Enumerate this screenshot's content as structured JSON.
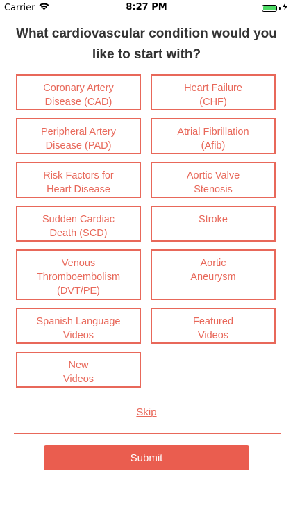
{
  "status_bar": {
    "carrier": "Carrier",
    "time": "8:27 PM",
    "wifi_icon": "wifi-icon",
    "battery_icon": "battery-icon",
    "charging_icon": "charging-bolt-icon",
    "battery_color": "#4cd964"
  },
  "question": "What cardiovascular condition would you like to start with?",
  "options": [
    {
      "label": "Coronary Artery\nDisease (CAD)"
    },
    {
      "label": "Heart Failure\n(CHF)"
    },
    {
      "label": "Peripheral Artery\nDisease (PAD)"
    },
    {
      "label": "Atrial Fibrillation\n(Afib)"
    },
    {
      "label": "Risk Factors for\nHeart Disease"
    },
    {
      "label": "Aortic Valve\nStenosis"
    },
    {
      "label": "Sudden Cardiac\nDeath (SCD)"
    },
    {
      "label": "Stroke"
    },
    {
      "label": "Venous\nThromboembolism\n(DVT/PE)"
    },
    {
      "label": "Aortic\nAneurysm"
    },
    {
      "label": "Spanish Language\nVideos"
    },
    {
      "label": "Featured\nVideos"
    },
    {
      "label": "New\nVideos"
    }
  ],
  "skip_label": "Skip",
  "submit_label": "Submit",
  "colors": {
    "accent": "#e8685a",
    "submit_bg": "#ea5d4f",
    "title": "#333333"
  }
}
